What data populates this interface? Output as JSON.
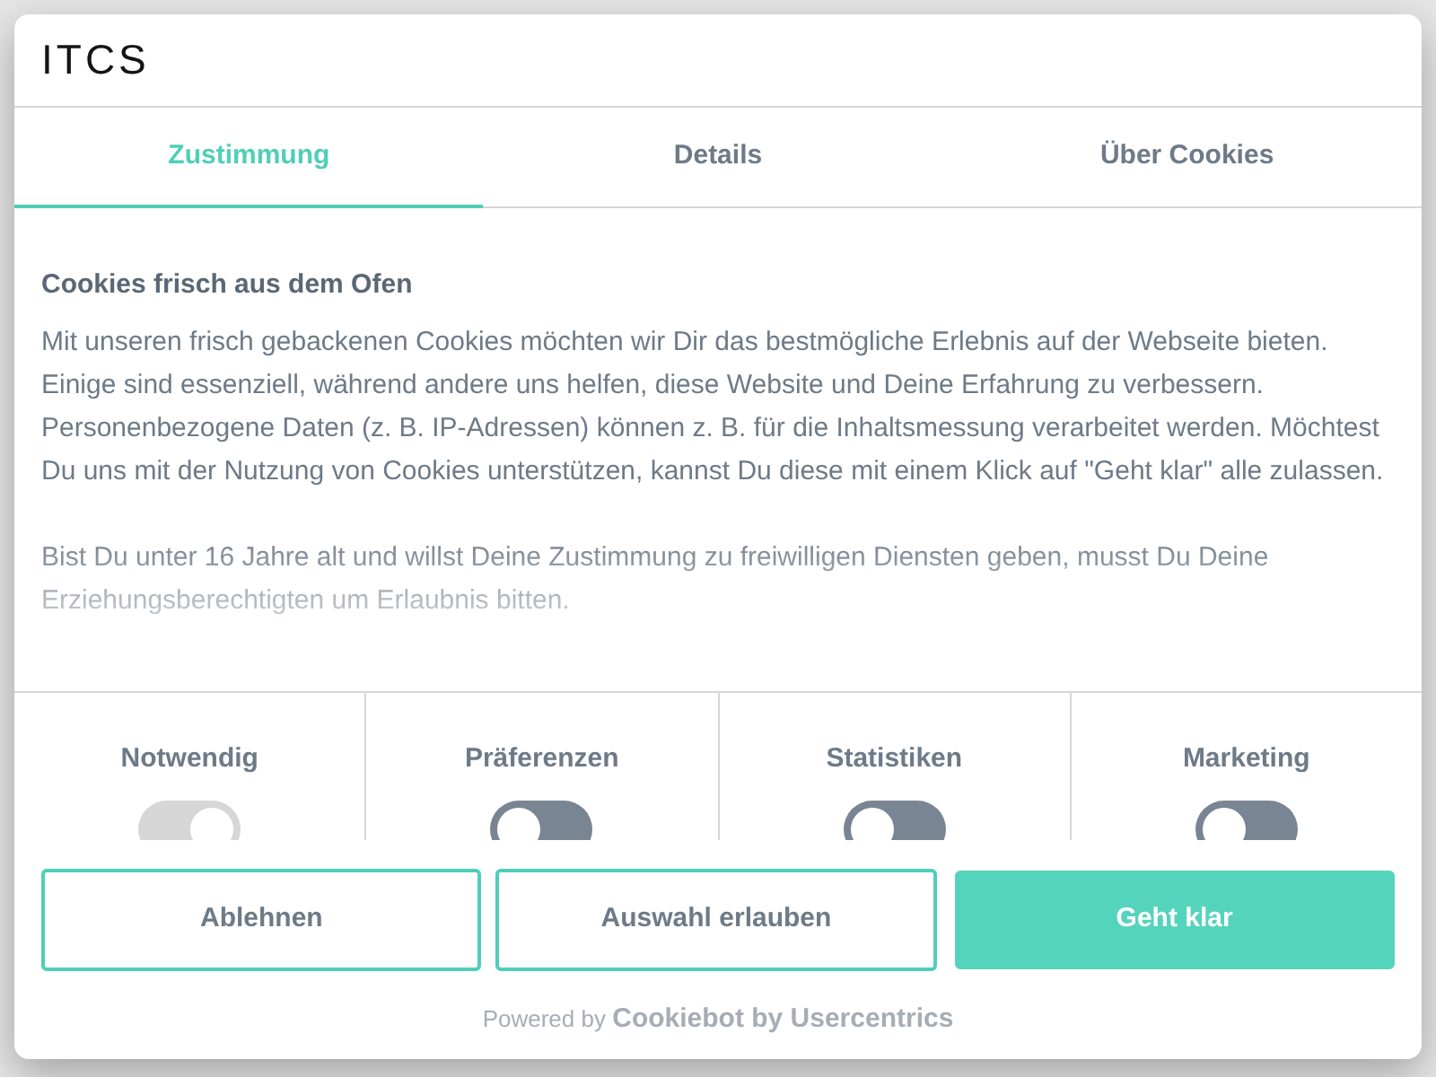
{
  "logo": "ITCS",
  "tabs": [
    {
      "label": "Zustimmung",
      "selected": true
    },
    {
      "label": "Details",
      "selected": false
    },
    {
      "label": "Über Cookies",
      "selected": false
    }
  ],
  "content": {
    "title": "Cookies frisch aus dem Ofen",
    "paragraphs": [
      "Mit unseren frisch gebackenen Cookies möchten wir Dir das bestmögliche Erlebnis auf der Webseite bieten. Einige sind essenziell, während andere uns helfen, diese Website und Deine Erfahrung zu verbessern. Personenbezogene Daten (z. B. IP-Adressen) können z. B. für die Inhaltsmessung verarbeitet werden. Möchtest Du uns mit der Nutzung von Cookies unterstützen, kannst Du diese mit einem Klick auf \"Geht klar\" alle zulassen.",
      "Bist Du unter 16 Jahre alt und willst Deine Zustimmung zu freiwilligen Diensten geben, musst Du Deine Erziehungsberechtigten um Erlaubnis bitten."
    ]
  },
  "categories": [
    {
      "label": "Notwendig",
      "checked": true,
      "disabled": true
    },
    {
      "label": "Präferenzen",
      "checked": false,
      "disabled": false
    },
    {
      "label": "Statistiken",
      "checked": false,
      "disabled": false
    },
    {
      "label": "Marketing",
      "checked": false,
      "disabled": false
    }
  ],
  "buttons": [
    {
      "label": "Ablehnen",
      "kind": "outline"
    },
    {
      "label": "Auswahl erlauben",
      "kind": "outline"
    },
    {
      "label": "Geht klar",
      "kind": "primary"
    }
  ],
  "footer": {
    "prefix": "Powered by",
    "brand": "Cookiebot by Usercentrics"
  }
}
